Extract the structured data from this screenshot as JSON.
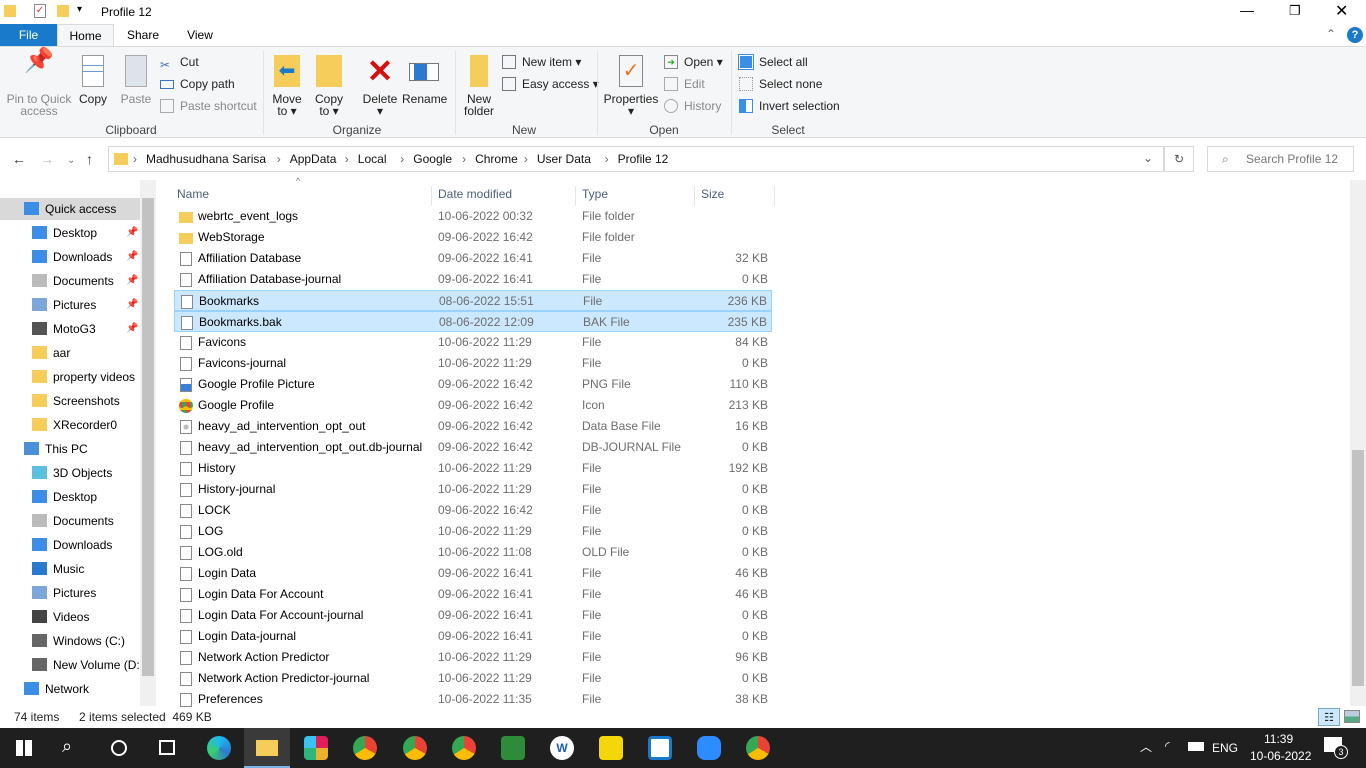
{
  "window": {
    "title": "Profile 12"
  },
  "tabs": [
    {
      "label": "File"
    },
    {
      "label": "Home"
    },
    {
      "label": "Share"
    },
    {
      "label": "View"
    }
  ],
  "ribbon": {
    "clipboard": {
      "label": "Clipboard",
      "pin": "Pin to Quick access",
      "copy": "Copy",
      "paste": "Paste",
      "cut": "Cut",
      "copy_path": "Copy path",
      "paste_shortcut": "Paste shortcut"
    },
    "organize": {
      "label": "Organize",
      "move_to": "Move to",
      "copy_to": "Copy to",
      "delete": "Delete",
      "rename": "Rename"
    },
    "new": {
      "label": "New",
      "new_folder": "New folder",
      "new_item": "New item",
      "easy_access": "Easy access"
    },
    "open": {
      "label": "Open",
      "properties": "Properties",
      "open": "Open",
      "edit": "Edit",
      "history": "History"
    },
    "select": {
      "label": "Select",
      "select_all": "Select all",
      "select_none": "Select none",
      "invert": "Invert selection"
    }
  },
  "address": {
    "crumbs": [
      "Madhusudhana Sarisa",
      "AppData",
      "Local",
      "Google",
      "Chrome",
      "User Data",
      "Profile 12"
    ],
    "search_placeholder": "Search Profile 12"
  },
  "sidebar": {
    "items": [
      {
        "label": "Quick access",
        "icon": "star",
        "level": 0,
        "selected": true
      },
      {
        "label": "Desktop",
        "icon": "desktop",
        "level": 1,
        "pinned": true
      },
      {
        "label": "Downloads",
        "icon": "download",
        "level": 1,
        "pinned": true
      },
      {
        "label": "Documents",
        "icon": "document",
        "level": 1,
        "pinned": true
      },
      {
        "label": "Pictures",
        "icon": "pictures",
        "level": 1,
        "pinned": true
      },
      {
        "label": "MotoG3",
        "icon": "phone",
        "level": 1,
        "pinned": true
      },
      {
        "label": "aar",
        "icon": "folder",
        "level": 1
      },
      {
        "label": "property videos",
        "icon": "folder",
        "level": 1
      },
      {
        "label": "Screenshots",
        "icon": "folder",
        "level": 1
      },
      {
        "label": "XRecorder0",
        "icon": "folder",
        "level": 1
      },
      {
        "label": "This PC",
        "icon": "pc",
        "level": 0
      },
      {
        "label": "3D Objects",
        "icon": "cube",
        "level": 1
      },
      {
        "label": "Desktop",
        "icon": "desktop",
        "level": 1
      },
      {
        "label": "Documents",
        "icon": "document",
        "level": 1
      },
      {
        "label": "Downloads",
        "icon": "download",
        "level": 1
      },
      {
        "label": "Music",
        "icon": "music",
        "level": 1
      },
      {
        "label": "Pictures",
        "icon": "pictures",
        "level": 1
      },
      {
        "label": "Videos",
        "icon": "video",
        "level": 1
      },
      {
        "label": "Windows (C:)",
        "icon": "drive",
        "level": 1
      },
      {
        "label": "New Volume (D:",
        "icon": "drive",
        "level": 1
      },
      {
        "label": "Network",
        "icon": "network",
        "level": 0
      }
    ]
  },
  "columns": {
    "name": "Name",
    "date": "Date modified",
    "type": "Type",
    "size": "Size"
  },
  "files": [
    {
      "name": "webrtc_event_logs",
      "date": "10-06-2022 00:32",
      "type": "File folder",
      "size": "",
      "icon": "folder"
    },
    {
      "name": "WebStorage",
      "date": "09-06-2022 16:42",
      "type": "File folder",
      "size": "",
      "icon": "folder"
    },
    {
      "name": "Affiliation Database",
      "date": "09-06-2022 16:41",
      "type": "File",
      "size": "32 KB",
      "icon": "file"
    },
    {
      "name": "Affiliation Database-journal",
      "date": "09-06-2022 16:41",
      "type": "File",
      "size": "0 KB",
      "icon": "file"
    },
    {
      "name": "Bookmarks",
      "date": "08-06-2022 15:51",
      "type": "File",
      "size": "236 KB",
      "icon": "file",
      "selected": true
    },
    {
      "name": "Bookmarks.bak",
      "date": "08-06-2022 12:09",
      "type": "BAK File",
      "size": "235 KB",
      "icon": "file",
      "selected": true
    },
    {
      "name": "Favicons",
      "date": "10-06-2022 11:29",
      "type": "File",
      "size": "84 KB",
      "icon": "file"
    },
    {
      "name": "Favicons-journal",
      "date": "10-06-2022 11:29",
      "type": "File",
      "size": "0 KB",
      "icon": "file"
    },
    {
      "name": "Google Profile Picture",
      "date": "09-06-2022 16:42",
      "type": "PNG File",
      "size": "110 KB",
      "icon": "image"
    },
    {
      "name": "Google Profile",
      "date": "09-06-2022 16:42",
      "type": "Icon",
      "size": "213 KB",
      "icon": "chrome"
    },
    {
      "name": "heavy_ad_intervention_opt_out",
      "date": "09-06-2022 16:42",
      "type": "Data Base File",
      "size": "16 KB",
      "icon": "db"
    },
    {
      "name": "heavy_ad_intervention_opt_out.db-journal",
      "date": "09-06-2022 16:42",
      "type": "DB-JOURNAL File",
      "size": "0 KB",
      "icon": "file"
    },
    {
      "name": "History",
      "date": "10-06-2022 11:29",
      "type": "File",
      "size": "192 KB",
      "icon": "file"
    },
    {
      "name": "History-journal",
      "date": "10-06-2022 11:29",
      "type": "File",
      "size": "0 KB",
      "icon": "file"
    },
    {
      "name": "LOCK",
      "date": "09-06-2022 16:42",
      "type": "File",
      "size": "0 KB",
      "icon": "file"
    },
    {
      "name": "LOG",
      "date": "10-06-2022 11:29",
      "type": "File",
      "size": "0 KB",
      "icon": "file"
    },
    {
      "name": "LOG.old",
      "date": "10-06-2022 11:08",
      "type": "OLD File",
      "size": "0 KB",
      "icon": "file"
    },
    {
      "name": "Login Data",
      "date": "09-06-2022 16:41",
      "type": "File",
      "size": "46 KB",
      "icon": "file"
    },
    {
      "name": "Login Data For Account",
      "date": "09-06-2022 16:41",
      "type": "File",
      "size": "46 KB",
      "icon": "file"
    },
    {
      "name": "Login Data For Account-journal",
      "date": "09-06-2022 16:41",
      "type": "File",
      "size": "0 KB",
      "icon": "file"
    },
    {
      "name": "Login Data-journal",
      "date": "09-06-2022 16:41",
      "type": "File",
      "size": "0 KB",
      "icon": "file"
    },
    {
      "name": "Network Action Predictor",
      "date": "10-06-2022 11:29",
      "type": "File",
      "size": "96 KB",
      "icon": "file"
    },
    {
      "name": "Network Action Predictor-journal",
      "date": "10-06-2022 11:29",
      "type": "File",
      "size": "0 KB",
      "icon": "file"
    },
    {
      "name": "Preferences",
      "date": "10-06-2022 11:35",
      "type": "File",
      "size": "38 KB",
      "icon": "file"
    }
  ],
  "status": {
    "items": "74 items",
    "selected": "2 items selected  469 KB"
  },
  "taskbar": {
    "apps": [
      "start",
      "search",
      "cortana",
      "task-view",
      "edge",
      "file-explorer",
      "slack",
      "chrome",
      "chrome-profile",
      "chrome-profile-2",
      "excel-like",
      "word-like",
      "sticky-notes",
      "outlook-like",
      "zoom",
      "chrome-3"
    ],
    "lang": "ENG",
    "time": "11:39",
    "date": "10-06-2022",
    "notifications": "3"
  },
  "colors": {
    "accent": "#1979ca",
    "selection": "#cce8ff",
    "taskbar": "#1f1f1f"
  }
}
